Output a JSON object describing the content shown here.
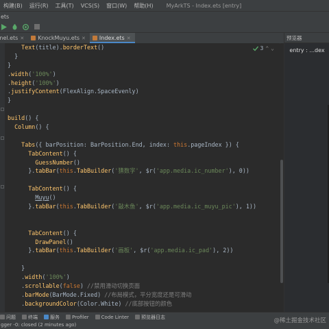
{
  "menubar": {
    "items": [
      "构建(B)",
      "运行(R)",
      "工具(T)",
      "VCS(S)",
      "窗口(W)",
      "帮助(H)"
    ],
    "window_title": "MyArkTS - Index.ets [entry]"
  },
  "pathbar": {
    "text": "ets"
  },
  "toolbar": {
    "icons": [
      "run-icon",
      "debug-icon",
      "profile-icon",
      "stop-icon"
    ]
  },
  "tabs": [
    {
      "label": "Panel.ets",
      "active": false
    },
    {
      "label": "KnockMuyu.ets",
      "active": false
    },
    {
      "label": "Index.ets",
      "active": true
    }
  ],
  "editor": {
    "inspection_count": "3",
    "lines": [
      [
        [
          "plain",
          "    "
        ],
        [
          "fn",
          "Text"
        ],
        [
          "plain",
          "(title)."
        ],
        [
          "fn",
          "borderText"
        ],
        [
          "plain",
          "()"
        ]
      ],
      [
        [
          "plain",
          "  }"
        ]
      ],
      [
        [
          "plain",
          "}"
        ]
      ],
      [
        [
          "plain",
          "."
        ],
        [
          "fn",
          "width"
        ],
        [
          "plain",
          "("
        ],
        [
          "str",
          "'100%'"
        ],
        [
          "plain",
          ")"
        ]
      ],
      [
        [
          "plain",
          "."
        ],
        [
          "fn",
          "height"
        ],
        [
          "plain",
          "("
        ],
        [
          "str",
          "'100%'"
        ],
        [
          "plain",
          ")"
        ]
      ],
      [
        [
          "plain",
          "."
        ],
        [
          "fn",
          "justifyContent"
        ],
        [
          "plain",
          "(FlexAlign.SpaceEvenly)"
        ]
      ],
      [
        [
          "plain",
          "}"
        ]
      ],
      [
        [
          "plain",
          ""
        ]
      ],
      [
        [
          "fn",
          "build"
        ],
        [
          "plain",
          "() {"
        ]
      ],
      [
        [
          "plain",
          "  "
        ],
        [
          "fn",
          "Column"
        ],
        [
          "plain",
          "() {"
        ]
      ],
      [
        [
          "plain",
          ""
        ]
      ],
      [
        [
          "plain",
          "    "
        ],
        [
          "fn",
          "Tabs"
        ],
        [
          "plain",
          "({ barPosition: BarPosition.End, index: "
        ],
        [
          "kw",
          "this"
        ],
        [
          "plain",
          ".pageIndex }) {"
        ]
      ],
      [
        [
          "plain",
          "      "
        ],
        [
          "fn",
          "TabContent"
        ],
        [
          "plain",
          "() {"
        ]
      ],
      [
        [
          "plain",
          "        "
        ],
        [
          "fn",
          "GuessNumber"
        ],
        [
          "plain",
          "()"
        ]
      ],
      [
        [
          "plain",
          "      }."
        ],
        [
          "fn",
          "tabBar"
        ],
        [
          "plain",
          "("
        ],
        [
          "kw",
          "this"
        ],
        [
          "plain",
          "."
        ],
        [
          "fn",
          "TabBuilder"
        ],
        [
          "plain",
          "("
        ],
        [
          "str",
          "'猜数字'"
        ],
        [
          "plain",
          ", $r("
        ],
        [
          "str",
          "'app.media.ic_number'"
        ],
        [
          "plain",
          "), 0))"
        ]
      ],
      [
        [
          "plain",
          ""
        ]
      ],
      [
        [
          "plain",
          "      "
        ],
        [
          "fn",
          "TabContent"
        ],
        [
          "plain",
          "() {"
        ]
      ],
      [
        [
          "plain",
          "        "
        ],
        [
          "under",
          "Muyu"
        ],
        [
          "plain",
          "()"
        ]
      ],
      [
        [
          "plain",
          "      }."
        ],
        [
          "fn",
          "tabBar"
        ],
        [
          "plain",
          "("
        ],
        [
          "kw",
          "this"
        ],
        [
          "plain",
          "."
        ],
        [
          "fn",
          "TabBuilder"
        ],
        [
          "plain",
          "("
        ],
        [
          "str",
          "'敲木鱼'"
        ],
        [
          "plain",
          ", $r("
        ],
        [
          "str",
          "'app.media.ic_muyu_pic'"
        ],
        [
          "plain",
          "), 1))"
        ]
      ],
      [
        [
          "plain",
          ""
        ]
      ],
      [
        [
          "plain",
          ""
        ]
      ],
      [
        [
          "plain",
          "      "
        ],
        [
          "fn",
          "TabContent"
        ],
        [
          "plain",
          "() {"
        ]
      ],
      [
        [
          "plain",
          "        "
        ],
        [
          "fn",
          "DrawPanel"
        ],
        [
          "plain",
          "()"
        ]
      ],
      [
        [
          "plain",
          "      }."
        ],
        [
          "fn",
          "tabBar"
        ],
        [
          "plain",
          "("
        ],
        [
          "kw",
          "this"
        ],
        [
          "plain",
          "."
        ],
        [
          "fn",
          "TabBuilder"
        ],
        [
          "plain",
          "("
        ],
        [
          "str",
          "'画板'"
        ],
        [
          "plain",
          ", $r("
        ],
        [
          "str",
          "'app.media.ic_pad'"
        ],
        [
          "plain",
          "), 2))"
        ]
      ],
      [
        [
          "plain",
          ""
        ]
      ],
      [
        [
          "plain",
          "    }"
        ]
      ],
      [
        [
          "plain",
          "    ."
        ],
        [
          "fn",
          "width"
        ],
        [
          "plain",
          "("
        ],
        [
          "str",
          "'100%'"
        ],
        [
          "plain",
          ")"
        ]
      ],
      [
        [
          "plain",
          "    ."
        ],
        [
          "fn",
          "scrollable"
        ],
        [
          "plain",
          "("
        ],
        [
          "kw",
          "false"
        ],
        [
          "plain",
          ") "
        ],
        [
          "comment",
          "//禁用滑动切换页面"
        ]
      ],
      [
        [
          "plain",
          "    ."
        ],
        [
          "fn",
          "barMode"
        ],
        [
          "plain",
          "(BarMode.Fixed) "
        ],
        [
          "comment",
          "//布局模式，平分宽度还是可滑动"
        ]
      ],
      [
        [
          "plain",
          "    ."
        ],
        [
          "fn",
          "backgroundColor"
        ],
        [
          "plain",
          "(Color.White) "
        ],
        [
          "comment",
          "//底部按钮的颜色"
        ]
      ]
    ]
  },
  "preview": {
    "header": "预览器",
    "entry": "entry : ...dex"
  },
  "bottom_toolbar": {
    "items": [
      {
        "label": "问题",
        "icon": "problems-icon"
      },
      {
        "label": "终端",
        "icon": "terminal-icon"
      },
      {
        "label": "服务",
        "icon": "services-icon"
      },
      {
        "label": "Profiler",
        "icon": "profiler-icon"
      },
      {
        "label": "Code Linter",
        "icon": "code-linter-icon"
      },
      {
        "label": "预览器日志",
        "icon": "previewer-log-icon"
      }
    ]
  },
  "statusbar": {
    "text": "gger -0: closed (2 minutes ago)"
  },
  "watermark": "@稀土掘金技术社区",
  "colors": {
    "background": "#2b2b2b",
    "panel": "#3c3f41",
    "function": "#ffc66d",
    "keyword": "#cc7832",
    "string": "#6a8759",
    "comment": "#808080",
    "accent": "#4a88c7",
    "run_green": "#59a869"
  }
}
